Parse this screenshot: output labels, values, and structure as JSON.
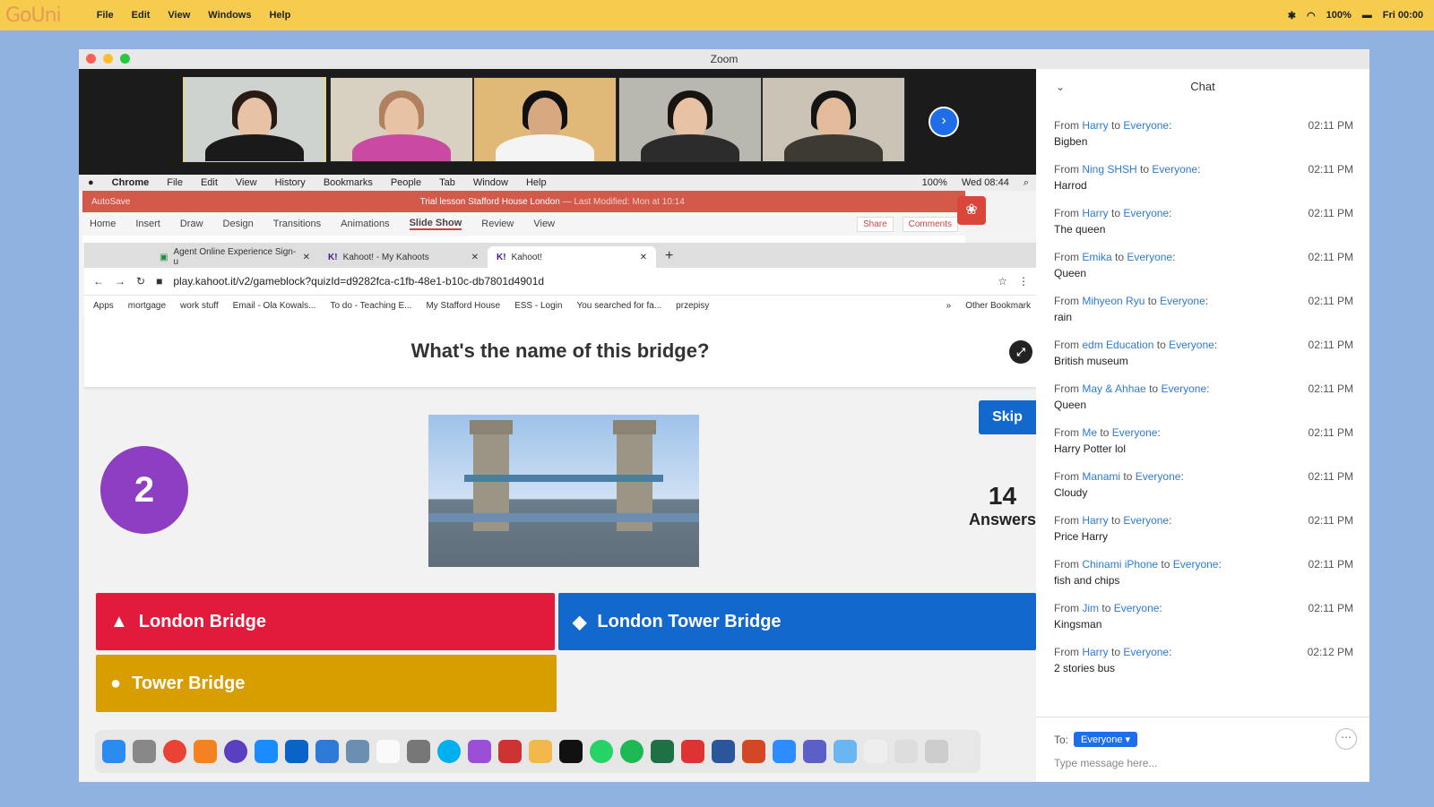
{
  "menubar": {
    "logo": "Go",
    "logo_suffix": "Uni",
    "items": [
      "File",
      "Edit",
      "View",
      "Windows",
      "Help"
    ],
    "battery": "100%",
    "clock": "Fri 00:00"
  },
  "zoom": {
    "title": "Zoom",
    "next_icon": "chevron-right-icon"
  },
  "mac_inner": {
    "items": [
      "Chrome",
      "File",
      "Edit",
      "View",
      "History",
      "Bookmarks",
      "People",
      "Tab",
      "Window",
      "Help"
    ],
    "battery": "100%",
    "clock": "Wed 08:44"
  },
  "powerpoint": {
    "autosave": "AutoSave",
    "doc_title": "Trial lesson Stafford House London",
    "modified": "— Last Modified: Mon at 10:14",
    "ribbon": [
      "Home",
      "Insert",
      "Draw",
      "Design",
      "Transitions",
      "Animations",
      "Slide Show",
      "Review",
      "View"
    ],
    "active_tab": "Slide Show",
    "share": "Share",
    "comments": "Comments"
  },
  "chrome": {
    "tabs": [
      {
        "label": "Agent Online Experience Sign-u"
      },
      {
        "label": "Kahoot! - My Kahoots"
      },
      {
        "label": "Kahoot!"
      }
    ],
    "url": "play.kahoot.it/v2/gameblock?quizId=d9282fca-c1fb-48e1-b10c-db7801d4901d",
    "bookmarks": [
      "Apps",
      "mortgage",
      "work stuff",
      "Email - Ola Kowals...",
      "To do - Teaching E...",
      "My Stafford House",
      "ESS - Login",
      "You searched for fa...",
      "przepisy",
      "»",
      "Other Bookmark"
    ]
  },
  "kahoot": {
    "question": "What's the name of this bridge?",
    "timer": "2",
    "skip": "Skip",
    "answers_count": "14",
    "answers_label": "Answers",
    "options": [
      {
        "label": "London Bridge",
        "shape": "triangle",
        "color": "#e21b3c"
      },
      {
        "label": "London Tower Bridge",
        "shape": "diamond",
        "color": "#1368ce"
      },
      {
        "label": "Tower Bridge",
        "shape": "circle",
        "color": "#d89e00"
      }
    ]
  },
  "chat": {
    "title": "Chat",
    "messages": [
      {
        "from": "Harry",
        "to": "Everyone",
        "time": "02:11 PM",
        "text": "Bigben"
      },
      {
        "from": "Ning SHSH",
        "to": "Everyone",
        "time": "02:11 PM",
        "text": "Harrod"
      },
      {
        "from": "Harry",
        "to": "Everyone",
        "time": "02:11 PM",
        "text": "The queen"
      },
      {
        "from": "Emika",
        "to": "Everyone",
        "time": "02:11 PM",
        "text": "Queen"
      },
      {
        "from": "Mihyeon Ryu",
        "to": "Everyone",
        "time": "02:11 PM",
        "text": "rain"
      },
      {
        "from": "edm Education",
        "to": "Everyone",
        "time": "02:11 PM",
        "text": "British museum"
      },
      {
        "from": "May & Ahhae",
        "to": "Everyone",
        "time": "02:11 PM",
        "text": "Queen"
      },
      {
        "from": "Me",
        "to": "Everyone",
        "time": "02:11 PM",
        "text": "Harry Potter lol"
      },
      {
        "from": "Manami",
        "to": "Everyone",
        "time": "02:11 PM",
        "text": "Cloudy"
      },
      {
        "from": "Harry",
        "to": "Everyone",
        "time": "02:11 PM",
        "text": "Price Harry"
      },
      {
        "from": "Chinami iPhone",
        "to": "Everyone",
        "time": "02:11 PM",
        "text": "fish and chips"
      },
      {
        "from": "Jim",
        "to": "Everyone",
        "time": "02:11 PM",
        "text": "Kingsman"
      },
      {
        "from": "Harry",
        "to": "Everyone",
        "time": "02:12 PM",
        "text": "2 stories bus"
      }
    ],
    "from_word": "From",
    "to_word": "to",
    "to_label": "To:",
    "to_value": "Everyone",
    "placeholder": "Type message here..."
  }
}
